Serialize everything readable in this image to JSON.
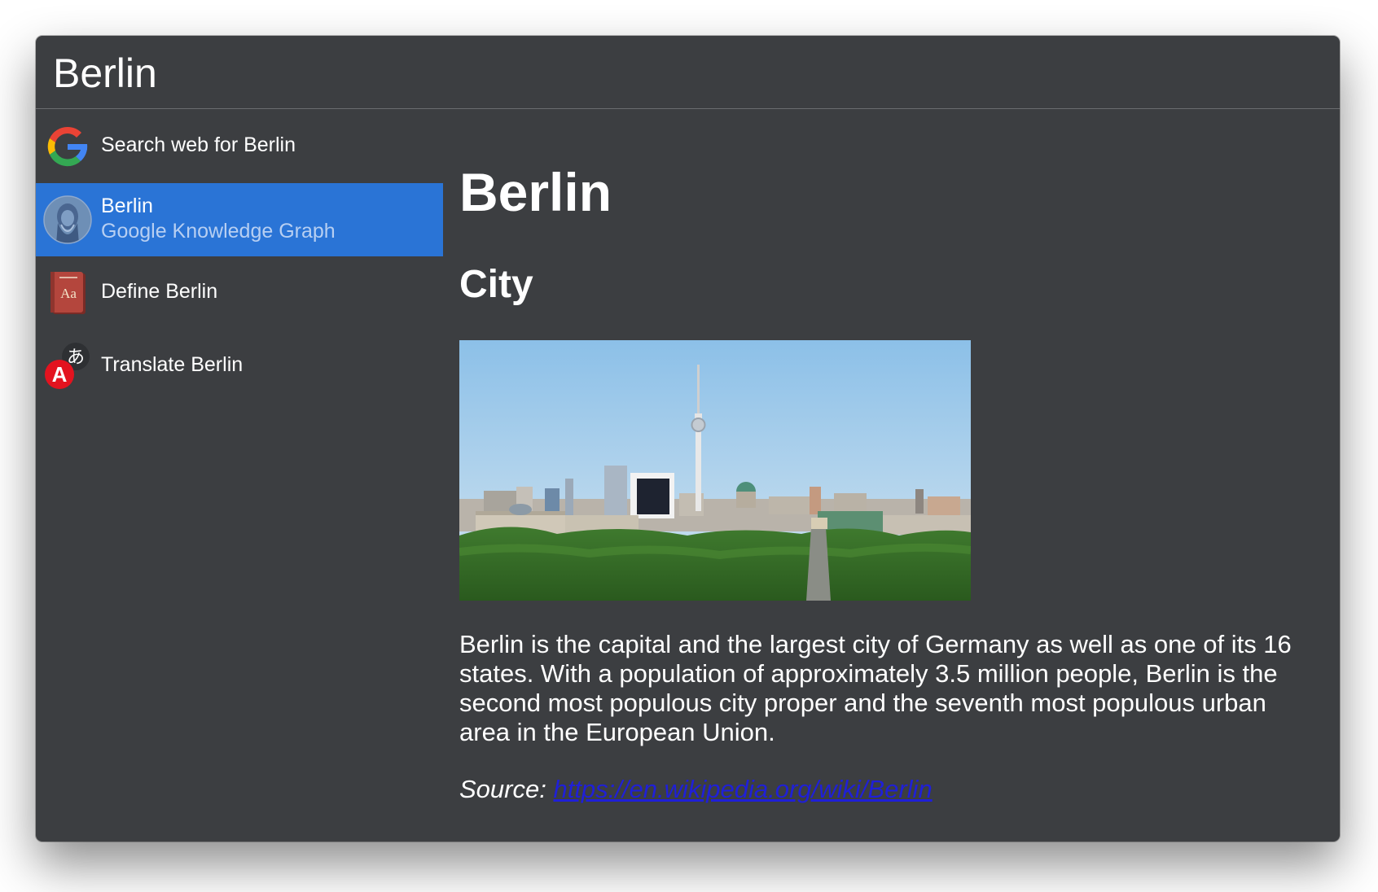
{
  "search": {
    "query": "Berlin"
  },
  "results": [
    {
      "title": "Search web for Berlin",
      "icon": "google-icon"
    },
    {
      "title": "Berlin",
      "subtitle": "Google Knowledge Graph",
      "icon": "knowledge-graph-icon",
      "selected": true
    },
    {
      "title": "Define Berlin",
      "icon": "dictionary-icon"
    },
    {
      "title": "Translate Berlin",
      "icon": "translate-icon"
    }
  ],
  "preview": {
    "title": "Berlin",
    "subtitle": "City",
    "image_alt": "Berlin skyline with TV tower",
    "description": "Berlin is the capital and the largest city of Germany as well as one of its 16 states. With a population of approximately 3.5 million people, Berlin is the second most populous city proper and the seventh most populous urban area in the European Union.",
    "source_label": "Source:",
    "source_url": "https://en.wikipedia.org/wiki/Berlin"
  },
  "colors": {
    "window_bg": "#3c3e41",
    "selected_bg": "#2a74d6",
    "link": "#1f1fd8"
  }
}
